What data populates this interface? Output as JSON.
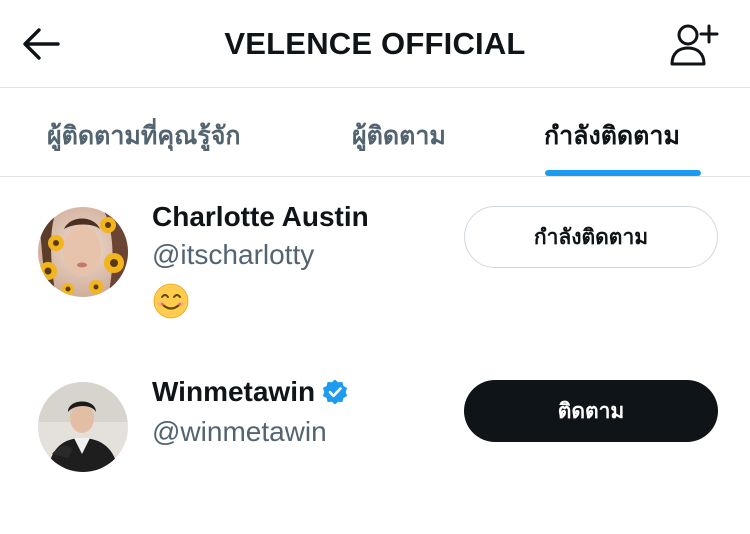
{
  "header": {
    "title": "VELENCE OFFICIAL",
    "back_icon": "arrow-left-icon",
    "add_user_icon": "add-user-icon"
  },
  "tabs": [
    {
      "label": "ผู้ติดตามที่คุณรู้จัก",
      "active": false
    },
    {
      "label": "ผู้ติดตาม",
      "active": false
    },
    {
      "label": "กำลังติดตาม",
      "active": true
    }
  ],
  "accent_color": "#1d9bf0",
  "users": [
    {
      "name": "Charlotte Austin",
      "handle": "@itscharlotty",
      "verified": false,
      "bio_icon": "smiling-face-emoji",
      "button_label": "กำลังติดตาม",
      "button_state": "following"
    },
    {
      "name": "Winmetawin",
      "handle": "@winmetawin",
      "verified": true,
      "button_label": "ติดตาม",
      "button_state": "follow"
    }
  ]
}
